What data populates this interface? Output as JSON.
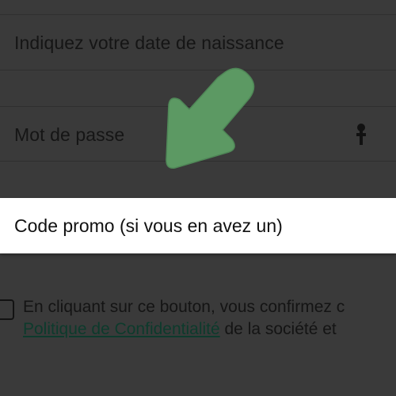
{
  "form": {
    "birthdate_placeholder": "Indiquez votre date de naissance",
    "password_placeholder": "Mot de passe",
    "promo_placeholder": "Code promo (si vous en avez un)",
    "consent": {
      "line1": "En cliquant sur ce bouton, vous confirmez c",
      "privacy_link": "Politique de Confidentialité",
      "line2_tail": " de la société et"
    }
  },
  "icons": {
    "password_toggle": "key-icon",
    "pointer": "arrow-pointer-icon"
  },
  "colors": {
    "overlay": "#3a3a3a",
    "highlight_field": "#ffffff",
    "arrow": "#5c9963",
    "link": "#0d3a2c"
  }
}
